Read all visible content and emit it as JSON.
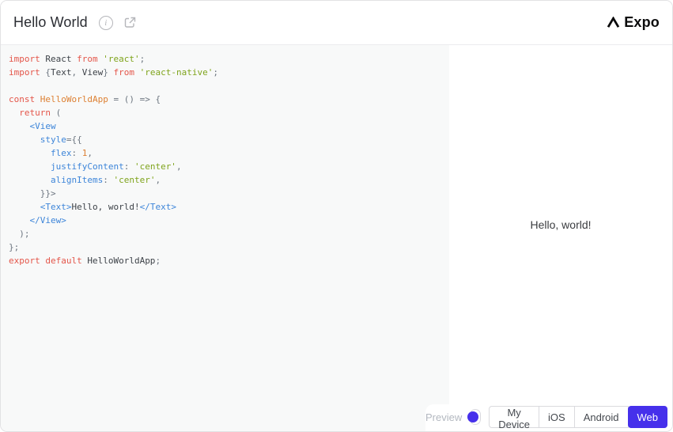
{
  "header": {
    "title": "Hello World",
    "logo": {
      "caret": "∧",
      "text": "Expo"
    }
  },
  "editor": {
    "lines": [
      [
        [
          "k",
          "import"
        ],
        [
          "p",
          " React "
        ],
        [
          "k",
          "from"
        ],
        [
          "s",
          " 'react'"
        ],
        [
          "g",
          ";"
        ]
      ],
      [
        [
          "k",
          "import"
        ],
        [
          "g",
          " {"
        ],
        [
          "p",
          "Text"
        ],
        [
          "g",
          ", "
        ],
        [
          "p",
          "View"
        ],
        [
          "g",
          "} "
        ],
        [
          "k",
          "from"
        ],
        [
          "s",
          " 'react-native'"
        ],
        [
          "g",
          ";"
        ]
      ],
      [],
      [
        [
          "k",
          "const"
        ],
        [
          "o",
          " HelloWorldApp"
        ],
        [
          "g",
          " = () => {"
        ]
      ],
      [
        [
          "k",
          "  return"
        ],
        [
          "g",
          " ("
        ]
      ],
      [
        [
          "b",
          "    <View"
        ]
      ],
      [
        [
          "b",
          "      style"
        ],
        [
          "g",
          "={{"
        ]
      ],
      [
        [
          "b",
          "        flex"
        ],
        [
          "g",
          ": "
        ],
        [
          "o",
          "1"
        ],
        [
          "g",
          ","
        ]
      ],
      [
        [
          "b",
          "        justifyContent"
        ],
        [
          "g",
          ": "
        ],
        [
          "s",
          "'center'"
        ],
        [
          "g",
          ","
        ]
      ],
      [
        [
          "b",
          "        alignItems"
        ],
        [
          "g",
          ": "
        ],
        [
          "s",
          "'center'"
        ],
        [
          "g",
          ","
        ]
      ],
      [
        [
          "g",
          "      }}>"
        ]
      ],
      [
        [
          "b",
          "      <Text>"
        ],
        [
          "p",
          "Hello, world!"
        ],
        [
          "b",
          "</Text>"
        ]
      ],
      [
        [
          "b",
          "    </View>"
        ]
      ],
      [
        [
          "g",
          "  );"
        ]
      ],
      [
        [
          "g",
          "};"
        ]
      ],
      [
        [
          "k",
          "export default"
        ],
        [
          "p",
          " HelloWorldApp"
        ],
        [
          "g",
          ";"
        ]
      ]
    ]
  },
  "preview": {
    "text": "Hello, world!"
  },
  "footer": {
    "preview_label": "Preview",
    "toggle": {
      "state": "on"
    },
    "device_tabs": [
      {
        "label": "My Device",
        "active": false
      },
      {
        "label": "iOS",
        "active": false
      },
      {
        "label": "Android",
        "active": false
      },
      {
        "label": "Web",
        "active": true
      }
    ]
  },
  "colors": {
    "accent": "#4630eb",
    "editor_bg": "#f8f9f9",
    "syntax": {
      "keyword": "#e4564a",
      "string": "#7fa41c",
      "property": "#3d85d9",
      "constant": "#dd8033",
      "plain": "#3d4248",
      "punctuation": "#6d7680"
    }
  }
}
